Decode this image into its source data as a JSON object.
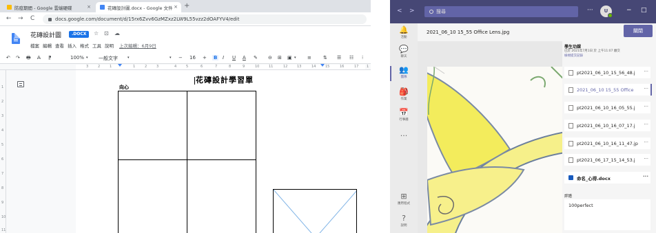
{
  "browser": {
    "tabs": [
      {
        "label": "防疫期間 - Google 雲端硬碟",
        "color": "#fbbc04"
      },
      {
        "label": "花磚設計圖.docx - Google 文件",
        "color": "#4285f4"
      }
    ],
    "tab_close": "×",
    "new_tab": "+",
    "back": "←",
    "forward": "→",
    "reload": "C",
    "url": "docs.google.com/document/d/15rx6Zvv6GzMZxz2LW9L55vzz2dOAFYV4/edit"
  },
  "doc": {
    "title": "花磚設計圖",
    "badge": ".DOCX",
    "star": "☆",
    "folder": "⊡",
    "cloud": "☁",
    "menu": [
      "檔案",
      "編輯",
      "查看",
      "插入",
      "格式",
      "工具",
      "說明"
    ],
    "last_edit": "上次編輯：6月9日",
    "toolbar": {
      "undo": "↶",
      "redo": "↷",
      "print": "🖶",
      "spell": "A̶",
      "paint": "⁋",
      "zoom": "100%",
      "zoom_arrow": "▾",
      "style": "一般文字",
      "style_arrow": "▾",
      "font_arrow": "▾",
      "minus": "−",
      "size": "16",
      "plus": "+",
      "bold": "B",
      "italic": "I",
      "underline": "U",
      "color": "A",
      "highlight": "✎",
      "link": "⊖",
      "comment": "⊞",
      "image": "▣",
      "image_arrow": "▾",
      "align": "≡",
      "linespace": "⇅",
      "checklist": "☰",
      "bullets": "☷",
      "numbered": "⁝"
    },
    "ruler_numbers": [
      "3",
      "2",
      "1",
      "1",
      "2",
      "3",
      "4",
      "5",
      "6",
      "7",
      "8",
      "9",
      "10",
      "11",
      "12",
      "13",
      "14",
      "15",
      "16",
      "17",
      "1"
    ],
    "vruler_numbers": [
      "1",
      "2",
      "3",
      "4",
      "5",
      "6",
      "7",
      "8",
      "9",
      "10",
      "11"
    ],
    "page_title": "花磚設計學習單",
    "label": "向心"
  },
  "teams": {
    "search_placeholder": "搜尋",
    "nav_back": "<",
    "nav_forward": ">",
    "more": "···",
    "avatar": "U",
    "win_min": "−",
    "win_max": "□",
    "rail": [
      {
        "icon": "🔔",
        "label": "活動"
      },
      {
        "icon": "💬",
        "label": "聊天"
      },
      {
        "icon": "👥",
        "label": "團隊"
      },
      {
        "icon": "🎒",
        "label": "作業"
      },
      {
        "icon": "📅",
        "label": "行事曆"
      },
      {
        "icon": "···",
        "label": ""
      },
      {
        "icon": "⊞",
        "label": "應用程式"
      },
      {
        "icon": "?",
        "label": "說明"
      }
    ],
    "file_name": "2021_06_10 15_55 Office Lens.jpg",
    "close_label": "關閉",
    "panel": {
      "heading": "學生功課",
      "sub": "已於 2021年7月1日 於 上午11:07 繳交",
      "link": "檢視提交記錄",
      "files": [
        {
          "name": "pt2021_06_10_15_56_48.j",
          "selected": false,
          "word": false
        },
        {
          "name": "2021_06_10 15_55 Office",
          "selected": true,
          "word": false
        },
        {
          "name": "pt2021_06_10_16_05_55.j",
          "selected": false,
          "word": false
        },
        {
          "name": "pt2021_06_10_16_07_17.j",
          "selected": false,
          "word": false
        },
        {
          "name": "pt2021_06_10_16_11_47.jp",
          "selected": false,
          "word": false
        },
        {
          "name": "pt2021_06_17_15_14_53.j",
          "selected": false,
          "word": false
        },
        {
          "name": "命名_心得.docx",
          "selected": false,
          "word": true
        }
      ],
      "item_more": "···",
      "comment_label": "評語",
      "comment": "100perfect"
    }
  }
}
